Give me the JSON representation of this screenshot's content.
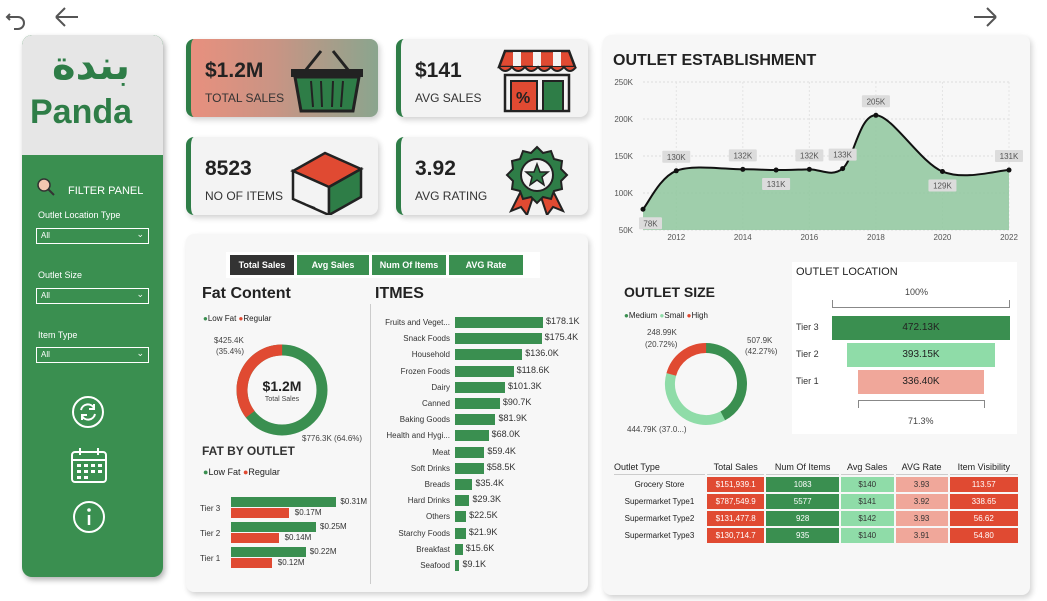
{
  "nav": {
    "undo_icon": "undo-arrow",
    "back_icon": "left-arrow",
    "forward_icon": "right-arrow"
  },
  "brand": {
    "arabic": "بندة",
    "latin": "Panda"
  },
  "filter": {
    "title": "FILTER PANEL",
    "fields": [
      {
        "label": "Outlet Location Type",
        "value": "All"
      },
      {
        "label": "Outlet Size",
        "value": "All"
      },
      {
        "label": "Item Type",
        "value": "All"
      }
    ]
  },
  "kpis": [
    {
      "value": "$1.2M",
      "label": "TOTAL SALES",
      "icon": "basket-icon"
    },
    {
      "value": "$141",
      "label": "AVG SALES",
      "icon": "shop-icon"
    },
    {
      "value": "8523",
      "label": "NO OF ITEMS",
      "icon": "box-icon"
    },
    {
      "value": "3.92",
      "label": "AVG RATING",
      "icon": "rating-badge-icon"
    }
  ],
  "tabs": [
    "Total Sales",
    "Avg Sales",
    "Num Of Items",
    "AVG Rate"
  ],
  "fat_content": {
    "title": "Fat Content",
    "legend": [
      "Low Fat",
      "Regular"
    ],
    "center_value": "$1.2M",
    "center_label": "Total Sales",
    "regular_label": "$425.4K",
    "regular_pct": "(35.4%)",
    "lowfat_label": "$776.3K (64.6%)",
    "regular_fraction": 0.354
  },
  "items": {
    "title": "ITMES",
    "rows": [
      {
        "name": "Fruits and Veget...",
        "value": "$178.1K",
        "num": 178.1
      },
      {
        "name": "Snack Foods",
        "value": "$175.4K",
        "num": 175.4
      },
      {
        "name": "Household",
        "value": "$136.0K",
        "num": 136.0
      },
      {
        "name": "Frozen Foods",
        "value": "$118.6K",
        "num": 118.6
      },
      {
        "name": "Dairy",
        "value": "$101.3K",
        "num": 101.3
      },
      {
        "name": "Canned",
        "value": "$90.7K",
        "num": 90.7
      },
      {
        "name": "Baking Goods",
        "value": "$81.9K",
        "num": 81.9
      },
      {
        "name": "Health and Hygi...",
        "value": "$68.0K",
        "num": 68.0
      },
      {
        "name": "Meat",
        "value": "$59.4K",
        "num": 59.4
      },
      {
        "name": "Soft Drinks",
        "value": "$58.5K",
        "num": 58.5
      },
      {
        "name": "Breads",
        "value": "$35.4K",
        "num": 35.4
      },
      {
        "name": "Hard Drinks",
        "value": "$29.3K",
        "num": 29.3
      },
      {
        "name": "Others",
        "value": "$22.5K",
        "num": 22.5
      },
      {
        "name": "Starchy Foods",
        "value": "$21.9K",
        "num": 21.9
      },
      {
        "name": "Breakfast",
        "value": "$15.6K",
        "num": 15.6
      },
      {
        "name": "Seafood",
        "value": "$9.1K",
        "num": 9.1
      }
    ]
  },
  "fat_by_outlet": {
    "title": "FAT BY OUTLET",
    "legend": [
      "Low Fat",
      "Regular"
    ],
    "rows": [
      {
        "tier": "Tier 3",
        "low": "$0.31M",
        "reg": "$0.17M",
        "lown": 0.31,
        "regn": 0.17
      },
      {
        "tier": "Tier 2",
        "low": "$0.25M",
        "reg": "$0.14M",
        "lown": 0.25,
        "regn": 0.14
      },
      {
        "tier": "Tier 1",
        "low": "$0.22M",
        "reg": "$0.12M",
        "lown": 0.22,
        "regn": 0.12
      }
    ]
  },
  "outlet_size": {
    "title": "OUTLET SIZE",
    "legend": [
      "Medium",
      "Small",
      "High"
    ],
    "medium": "507.9K",
    "medium_pct": "(42.27%)",
    "small": "444.79K (37.0...)",
    "high": "248.99K",
    "high_pct": "(20.72%)",
    "fractions": [
      0.4227,
      0.3701,
      0.2072
    ]
  },
  "outlet_location": {
    "title": "OUTLET LOCATION",
    "top": "100%",
    "bottom": "71.3%",
    "rows": [
      {
        "tier": "Tier 3",
        "value": "472.13K",
        "num": 472.13
      },
      {
        "tier": "Tier 2",
        "value": "393.15K",
        "num": 393.15
      },
      {
        "tier": "Tier 1",
        "value": "336.40K",
        "num": 336.4
      }
    ]
  },
  "outlet_table": {
    "headers": [
      "Outlet Type",
      "Total Sales",
      "Num Of Items",
      "Avg Sales",
      "AVG Rate",
      "Item Visibility"
    ],
    "rows": [
      [
        "Grocery Store",
        "$151,939.1",
        "1083",
        "$140",
        "3.93",
        "113.57"
      ],
      [
        "Supermarket Type1",
        "$787,549.9",
        "5577",
        "$141",
        "3.92",
        "338.65"
      ],
      [
        "Supermarket Type2",
        "$131,477.8",
        "928",
        "$142",
        "3.93",
        "56.62"
      ],
      [
        "Supermarket Type3",
        "$130,714.7",
        "935",
        "$140",
        "3.91",
        "54.80"
      ]
    ]
  },
  "colors": {
    "green": "#3a8f50",
    "red": "#e04a32",
    "light_green": "#8fdca8",
    "pink": "#f0a79a",
    "light_red": "#ef6a57"
  },
  "chart_data": [
    {
      "type": "area",
      "title": "OUTLET ESTABLISHMENT",
      "x": [
        2011,
        2012,
        2014,
        2015,
        2016,
        2017,
        2018,
        2020,
        2022
      ],
      "values": [
        78,
        130,
        132,
        131,
        132,
        133,
        205,
        129,
        131
      ],
      "labels": [
        "78K",
        "130K",
        "132K",
        "131K",
        "132K",
        "133K",
        "205K",
        "129K",
        "131K"
      ],
      "yticks": [
        "50K",
        "100K",
        "150K",
        "200K",
        "250K"
      ],
      "xticks": [
        "2012",
        "2014",
        "2016",
        "2018",
        "2020",
        "2022"
      ],
      "ylim": [
        50,
        250
      ],
      "xlim": [
        2011,
        2022
      ],
      "grid": true
    }
  ]
}
